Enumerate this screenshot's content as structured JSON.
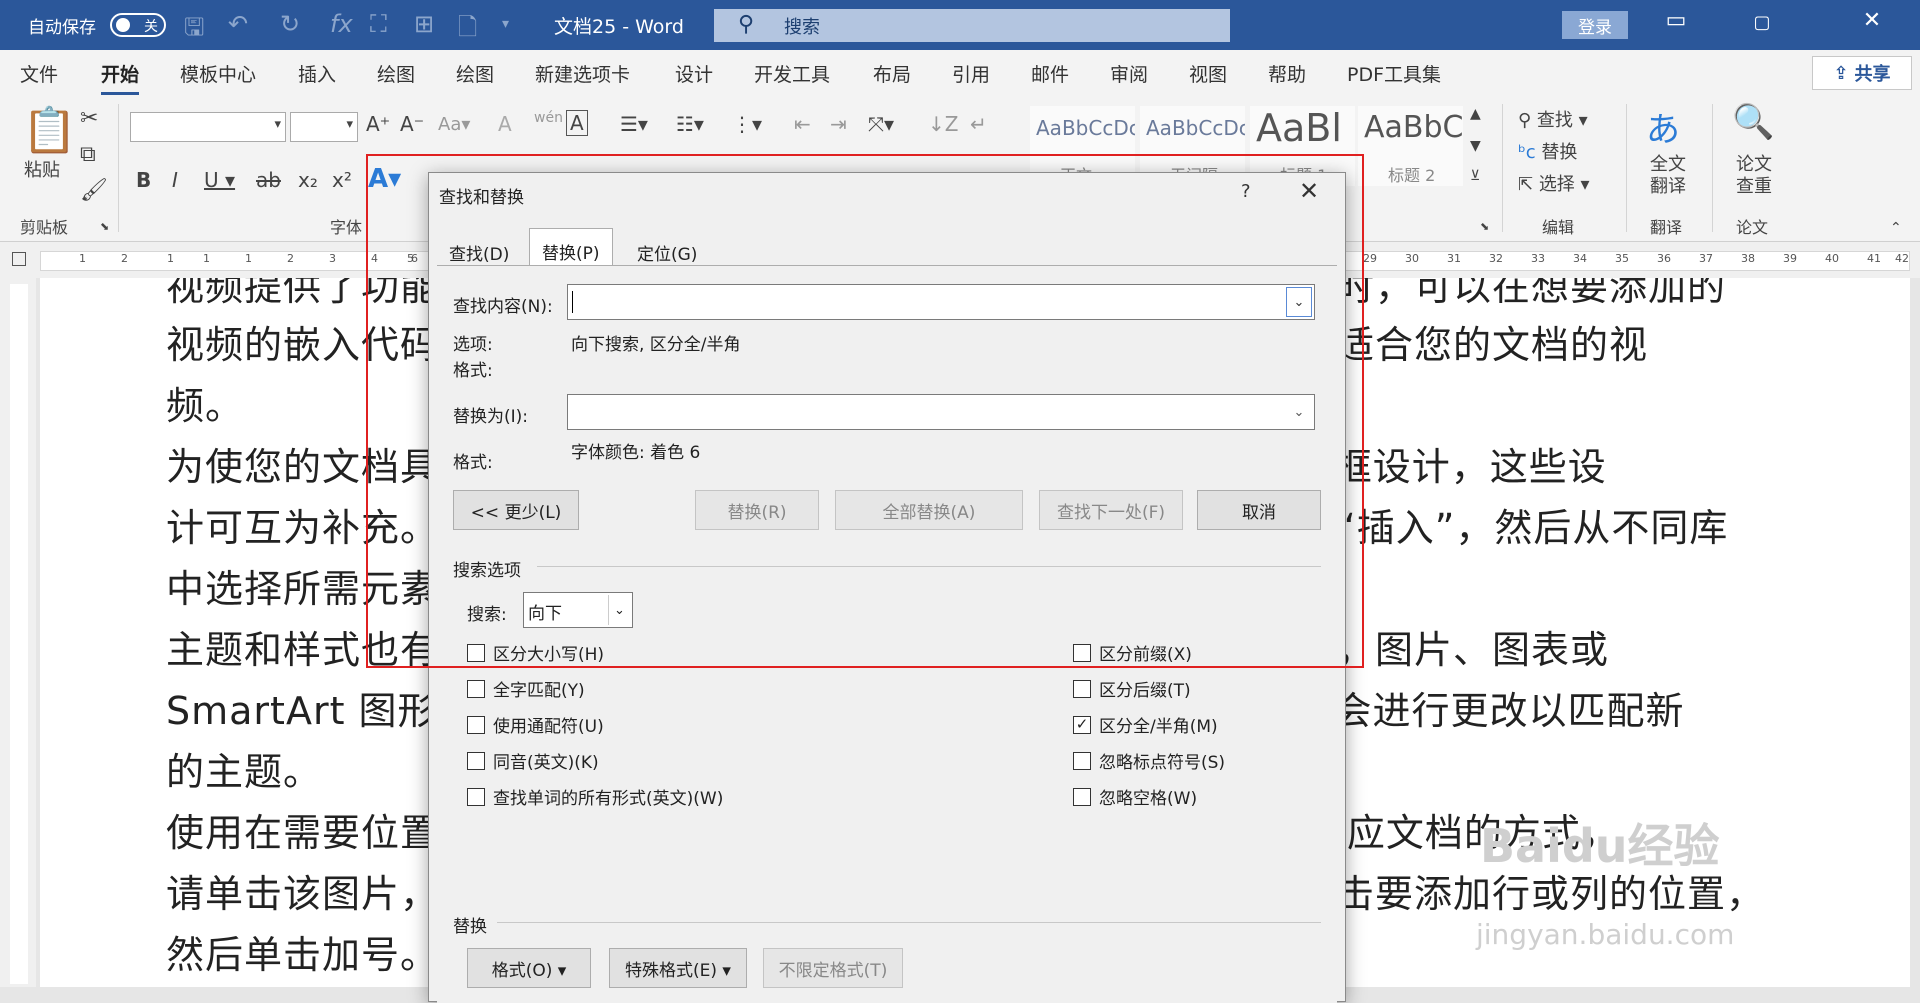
{
  "titlebar": {
    "autosave_label": "自动保存",
    "autosave_state": "关",
    "doc_title": "文档25 - Word",
    "search_placeholder": "搜索",
    "login": "登录",
    "restore_icon": "▭",
    "min_icon": "▢",
    "close_icon": "✕"
  },
  "menu": {
    "items": [
      "文件",
      "开始",
      "模板中心",
      "插入",
      "绘图",
      "绘图",
      "新建选项卡",
      "设计",
      "开发工具",
      "布局",
      "引用",
      "邮件",
      "审阅",
      "视图",
      "帮助",
      "PDF工具集"
    ],
    "active": "开始",
    "share": "共享"
  },
  "ribbon": {
    "clipboard": {
      "paste": "粘贴",
      "label": "剪贴板"
    },
    "font_label": "字体",
    "styles": [
      {
        "sample": "AaBbCcDc",
        "name": "正文"
      },
      {
        "sample": "AaBbCcDc",
        "name": "无间隔"
      },
      {
        "sample": "AaBl",
        "name": "标题 1"
      },
      {
        "sample": "AaBbC",
        "name": "标题 2"
      }
    ],
    "editing": {
      "find": "查找",
      "replace": "替换",
      "select": "选择",
      "label": "编辑"
    },
    "translate": {
      "btn": "全文\n翻译",
      "label": "翻译"
    },
    "paper": {
      "btn": "论文\n查重",
      "label": "论文"
    }
  },
  "ruler_ticks": [
    "1",
    "2",
    "1",
    "1",
    "1",
    "2",
    "3",
    "4",
    "5",
    "6",
    "29",
    "30",
    "31",
    "32",
    "33",
    "34",
    "35",
    "36",
    "37",
    "38",
    "39",
    "40",
    "41",
    "42"
  ],
  "document": {
    "lines": [
      "视频提供了功能强大的方法帮助您证明您的观点。当您单击联机视频时，可以在想要添加的",
      "视频的嵌入代码中进行粘贴。您也可以键入一个关键字以联机搜索最适合您的文档的视",
      "频。",
      "为使您的文档具有专业外观，Word 提供了页眉、页脚、封面和文本框设计，这些设",
      "计可互为补充。例如，您可以添加匹配的封面、页眉和提要栏。单击“插入”，然后从不同库",
      "中选择所需元素。",
      "主题和样式也有助于文档保持协调。当您单击设计并选择新的主题时，图片、图表或",
      "SmartArt 图形将会更改以匹配新的主题。当应用样式时，您的标题会进行更改以匹配新",
      "的主题。",
      "使用在需要位置出现的新按钮在 Word 中保存时间。若要更改图片适应文档的方式，",
      "请单击该图片，图片旁边将会显示布局选项按钮。当处理表格时，单击要添加行或列的位置，",
      "然后单击加号。"
    ],
    "watermark": "Baidu经验",
    "watermark_url": "jingyan.baidu.com"
  },
  "dialog": {
    "title": "查找和替换",
    "help": "?",
    "close": "✕",
    "tabs": [
      "查找(D)",
      "替换(P)",
      "定位(G)"
    ],
    "active_tab": "替换(P)",
    "find_label": "查找内容(N):",
    "find_value": "",
    "options_label": "选项:",
    "options_value": "向下搜索, 区分全/半角",
    "format_label": "格式:",
    "replace_label": "替换为(I):",
    "replace_value": "",
    "replace_format_label": "格式:",
    "replace_format_value": "字体颜色: 着色 6",
    "buttons": {
      "less": "<< 更少(L)",
      "replace": "替换(R)",
      "replace_all": "全部替换(A)",
      "find_next": "查找下一处(F)",
      "cancel": "取消"
    },
    "search_options_label": "搜索选项",
    "search_label": "搜索:",
    "search_dir": "向下",
    "checks_left": [
      {
        "label": "区分大小写(H)",
        "checked": false
      },
      {
        "label": "全字匹配(Y)",
        "checked": false
      },
      {
        "label": "使用通配符(U)",
        "checked": false
      },
      {
        "label": "同音(英文)(K)",
        "checked": false
      },
      {
        "label": "查找单词的所有形式(英文)(W)",
        "checked": false
      }
    ],
    "checks_right": [
      {
        "label": "区分前缀(X)",
        "checked": false
      },
      {
        "label": "区分后缀(T)",
        "checked": false
      },
      {
        "label": "区分全/半角(M)",
        "checked": true
      },
      {
        "label": "忽略标点符号(S)",
        "checked": false
      },
      {
        "label": "忽略空格(W)",
        "checked": false
      }
    ],
    "replace_section_label": "替换",
    "format_btn": "格式(O) ▾",
    "special_btn": "特殊格式(E) ▾",
    "no_format_btn": "不限定格式(T)"
  },
  "colors": {
    "title_bar": "#2b579a",
    "highlight_box": "#e02020"
  }
}
